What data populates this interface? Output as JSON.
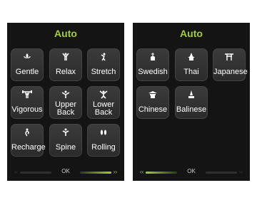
{
  "left_screen": {
    "title": "Auto",
    "tiles": [
      {
        "label": "Gentle",
        "icon": "lotus-icon"
      },
      {
        "label": "Relax",
        "icon": "person-arms-up-icon"
      },
      {
        "label": "Stretch",
        "icon": "person-stretch-icon"
      },
      {
        "label": "Vigorous",
        "icon": "weightlifter-icon"
      },
      {
        "label": "Upper Back",
        "icon": "upper-back-icon"
      },
      {
        "label": "Lower Back",
        "icon": "lower-back-icon"
      },
      {
        "label": "Recharge",
        "icon": "person-recharge-icon"
      },
      {
        "label": "Spine",
        "icon": "spine-icon"
      },
      {
        "label": "Rolling",
        "icon": "feet-icon"
      }
    ],
    "ok_label": "OK"
  },
  "right_screen": {
    "title": "Auto",
    "tiles": [
      {
        "label": "Swedish",
        "icon": "church-icon"
      },
      {
        "label": "Thai",
        "icon": "thai-temple-icon"
      },
      {
        "label": "Japanese",
        "icon": "torii-gate-icon"
      },
      {
        "label": "Chinese",
        "icon": "pagoda-icon"
      },
      {
        "label": "Balinese",
        "icon": "bali-shrine-icon"
      }
    ],
    "ok_label": "OK"
  },
  "colors": {
    "accent": "#a6cc3b",
    "screen_bg": "#141414",
    "tile_bg": "#333333"
  }
}
